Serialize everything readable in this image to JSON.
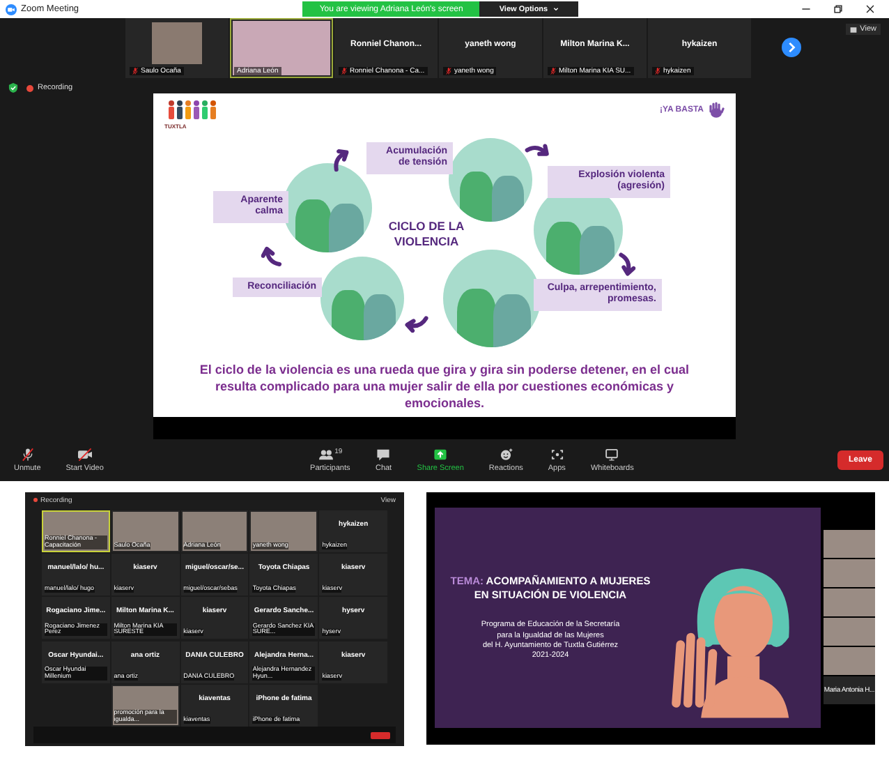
{
  "window": {
    "title": "Zoom Meeting"
  },
  "banner": {
    "text": "You are viewing Adriana León's screen",
    "view_options": "View Options"
  },
  "strip": {
    "tiles": [
      {
        "kind": "video",
        "label": "Saulo Ocaña",
        "muted": true,
        "speaking": false
      },
      {
        "kind": "video",
        "label": "Adriana León",
        "muted": false,
        "speaking": true
      },
      {
        "kind": "name",
        "name": "Ronniel  Chanon...",
        "label": "Ronniel Chanona - Ca...",
        "muted": true,
        "speaking": false
      },
      {
        "kind": "name",
        "name": "yaneth wong",
        "label": "yaneth wong",
        "muted": true,
        "speaking": false
      },
      {
        "kind": "name",
        "name": "Milton  Marina  K...",
        "label": "Milton Marina KIA SU...",
        "muted": true,
        "speaking": false
      },
      {
        "kind": "name",
        "name": "hykaizen",
        "label": "hykaizen",
        "muted": true,
        "speaking": false
      }
    ],
    "view": "View"
  },
  "recording": "Recording",
  "slide": {
    "logo_left": "TUXTLA",
    "logo_right": "¡YA BASTA",
    "title": "CICLO DE LA VIOLENCIA",
    "stages": [
      "Acumulación de tensión",
      "Explosión violenta (agresión)",
      "Aparente calma",
      "Reconciliación",
      "Culpa, arrepentimiento, promesas."
    ],
    "caption": "El ciclo de la violencia es una rueda que gira y gira sin poderse detener, en el cual resulta complicado para una mujer salir de ella por cuestiones económicas y emocionales."
  },
  "toolbar": {
    "left": [
      {
        "kind": "mic",
        "label": "Unmute"
      },
      {
        "kind": "camera",
        "label": "Start Video"
      }
    ],
    "center": [
      {
        "kind": "participants",
        "label": "Participants",
        "count": "19"
      },
      {
        "kind": "chat",
        "label": "Chat"
      },
      {
        "kind": "share",
        "label": "Share Screen"
      },
      {
        "kind": "reactions",
        "label": "Reactions"
      },
      {
        "kind": "apps",
        "label": "Apps"
      },
      {
        "kind": "whiteboards",
        "label": "Whiteboards"
      }
    ],
    "leave": "Leave"
  },
  "gallery_shot": {
    "recording": "Recording",
    "view": "View",
    "tiles": [
      {
        "kind": "video",
        "label": "Ronniel Chanona - Capacitación",
        "speaking": true
      },
      {
        "kind": "video",
        "label": "Saulo Ocaña",
        "speaking": false
      },
      {
        "kind": "video",
        "label": "Adriana León",
        "speaking": false
      },
      {
        "kind": "video",
        "label": "yaneth wong",
        "speaking": false
      },
      {
        "kind": "name",
        "name": "hykaizen",
        "label": "hykaizen",
        "speaking": false
      },
      {
        "kind": "name",
        "name": "manuel/lalo/ hu...",
        "label": "manuel/lalo/ hugo",
        "speaking": false
      },
      {
        "kind": "name",
        "name": "kiaserv",
        "label": "kiaserv",
        "speaking": false
      },
      {
        "kind": "name",
        "name": "miguel/oscar/se...",
        "label": "miguel/oscar/sebas",
        "speaking": false
      },
      {
        "kind": "name",
        "name": "Toyota Chiapas",
        "label": "Toyota Chiapas",
        "speaking": false
      },
      {
        "kind": "name",
        "name": "kiaserv",
        "label": "kiaserv",
        "speaking": false
      },
      {
        "kind": "name",
        "name": "Rogaciano Jime...",
        "label": "Rogaciano Jimenez Perez",
        "speaking": false
      },
      {
        "kind": "name",
        "name": "Milton Marina K...",
        "label": "Milton Marina KIA SURESTE",
        "speaking": false
      },
      {
        "kind": "name",
        "name": "kiaserv",
        "label": "kiaserv",
        "speaking": false
      },
      {
        "kind": "name",
        "name": "Gerardo Sanche...",
        "label": "Gerardo Sanchez KIA SURE...",
        "speaking": false
      },
      {
        "kind": "name",
        "name": "hyserv",
        "label": "hyserv",
        "speaking": false
      },
      {
        "kind": "name",
        "name": "Oscar Hyundai...",
        "label": "Oscar Hyundai Millenium",
        "speaking": false
      },
      {
        "kind": "name",
        "name": "ana ortiz",
        "label": "ana ortiz",
        "speaking": false
      },
      {
        "kind": "name",
        "name": "DANIA CULEBRO",
        "label": "DANIA CULEBRO",
        "speaking": false
      },
      {
        "kind": "name",
        "name": "Alejandra Herna...",
        "label": "Alejandra Hernandez Hyun...",
        "speaking": false
      },
      {
        "kind": "name",
        "name": "kiaserv",
        "label": "kiaserv",
        "speaking": false
      },
      {
        "kind": "blank"
      },
      {
        "kind": "video",
        "label": "promoción para la igualda...",
        "speaking": false
      },
      {
        "kind": "name",
        "name": "kiaventas",
        "label": "kiaventas",
        "speaking": false
      },
      {
        "kind": "name",
        "name": "iPhone de fatima",
        "label": "iPhone de fatima",
        "speaking": false
      }
    ]
  },
  "presentation_shot": {
    "tema": "TEMA:",
    "title": "ACOMPAÑAMIENTO A MUJERES EN SITUACIÓN DE VIOLENCIA",
    "program": [
      "Programa de Educación de la Secretaría",
      "para la Igualdad de las Mujeres",
      "del H. Ayuntamiento de Tuxtla Gutiérrez",
      "2021-2024"
    ],
    "side_tiles": [
      {
        "kind": "video"
      },
      {
        "kind": "video"
      },
      {
        "kind": "video"
      },
      {
        "kind": "video"
      },
      {
        "kind": "video"
      },
      {
        "kind": "name",
        "name": "Maria Antonia H..."
      }
    ]
  }
}
